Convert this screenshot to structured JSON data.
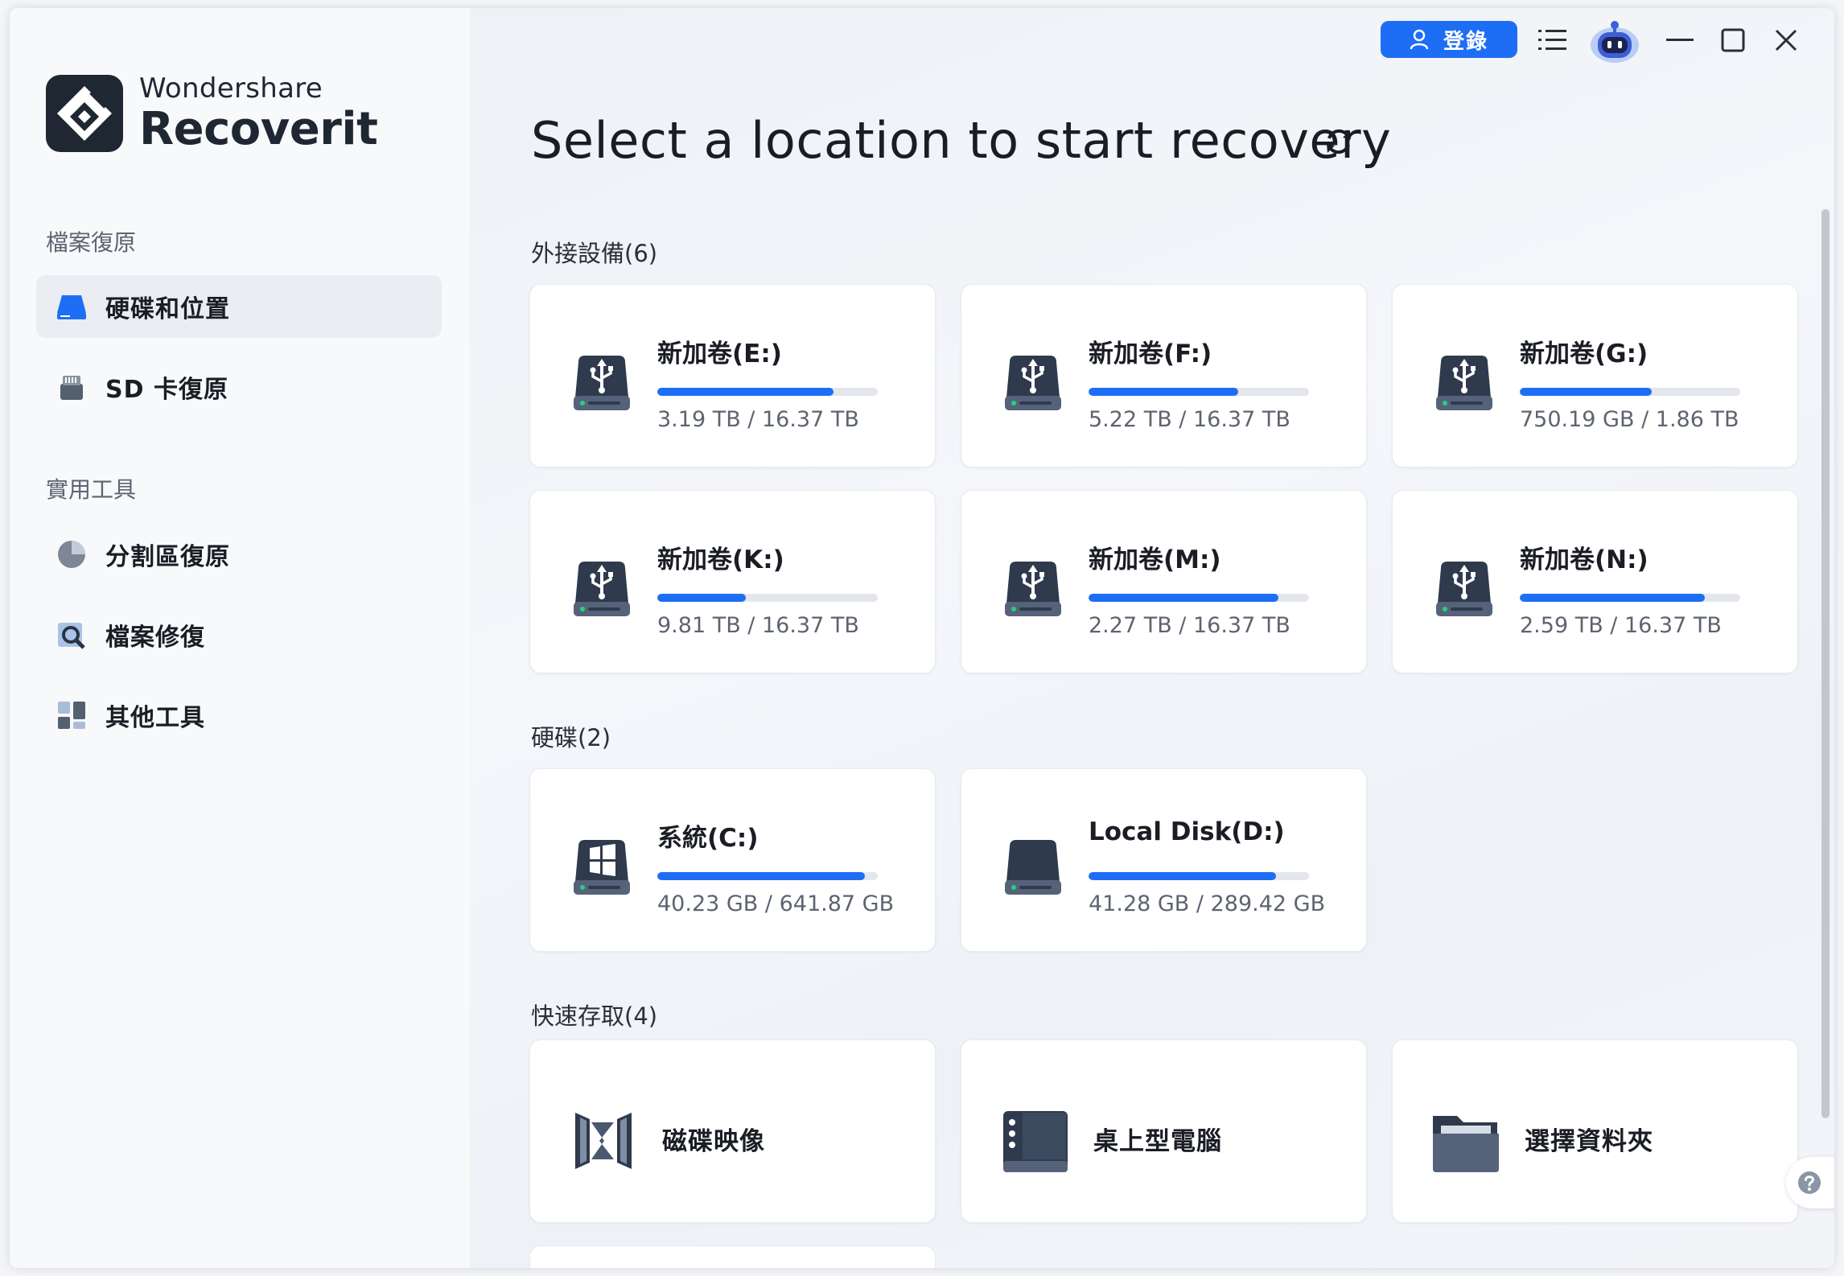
{
  "app": {
    "brand": "Wondershare",
    "product": "Recoverit"
  },
  "header": {
    "login_label": "登錄",
    "title": "Select a location to start recovery"
  },
  "sidebar": {
    "section1": "檔案復原",
    "section2": "實用工具",
    "items": [
      {
        "label": "硬碟和位置",
        "icon": "hard-drive-icon",
        "active": true
      },
      {
        "label": "SD 卡復原",
        "icon": "sd-card-icon",
        "active": false
      },
      {
        "label": "分割區復原",
        "icon": "pie-chart-icon",
        "active": false
      },
      {
        "label": "檔案修復",
        "icon": "file-repair-icon",
        "active": false
      },
      {
        "label": "其他工具",
        "icon": "grid-tools-icon",
        "active": false
      }
    ]
  },
  "sections": {
    "external": "外接設備(6)",
    "disks": "硬碟(2)",
    "quick": "快速存取(4)"
  },
  "external_drives": [
    {
      "name": "新加卷(E:)",
      "size": "3.19 TB / 16.37 TB",
      "fill": 0.8
    },
    {
      "name": "新加卷(F:)",
      "size": "5.22 TB / 16.37 TB",
      "fill": 0.68
    },
    {
      "name": "新加卷(G:)",
      "size": "750.19 GB / 1.86 TB",
      "fill": 0.6
    },
    {
      "name": "新加卷(K:)",
      "size": "9.81 TB / 16.37 TB",
      "fill": 0.4
    },
    {
      "name": "新加卷(M:)",
      "size": "2.27 TB / 16.37 TB",
      "fill": 0.86
    },
    {
      "name": "新加卷(N:)",
      "size": "2.59 TB / 16.37 TB",
      "fill": 0.84
    }
  ],
  "hard_disks": [
    {
      "name": "系統(C:)",
      "size": "40.23 GB / 641.87 GB",
      "fill": 0.94,
      "icon": "windows-drive-icon"
    },
    {
      "name": "Local Disk(D:)",
      "size": "41.28 GB / 289.42 GB",
      "fill": 0.85,
      "icon": "hard-disk-icon"
    }
  ],
  "quick_access": [
    {
      "name": "磁碟映像",
      "icon": "disk-image-icon"
    },
    {
      "name": "桌上型電腦",
      "icon": "desktop-icon"
    },
    {
      "name": "選擇資料夾",
      "icon": "folder-icon"
    }
  ],
  "colors": {
    "accent": "#1e6ef5",
    "dark": "#1f2733"
  }
}
